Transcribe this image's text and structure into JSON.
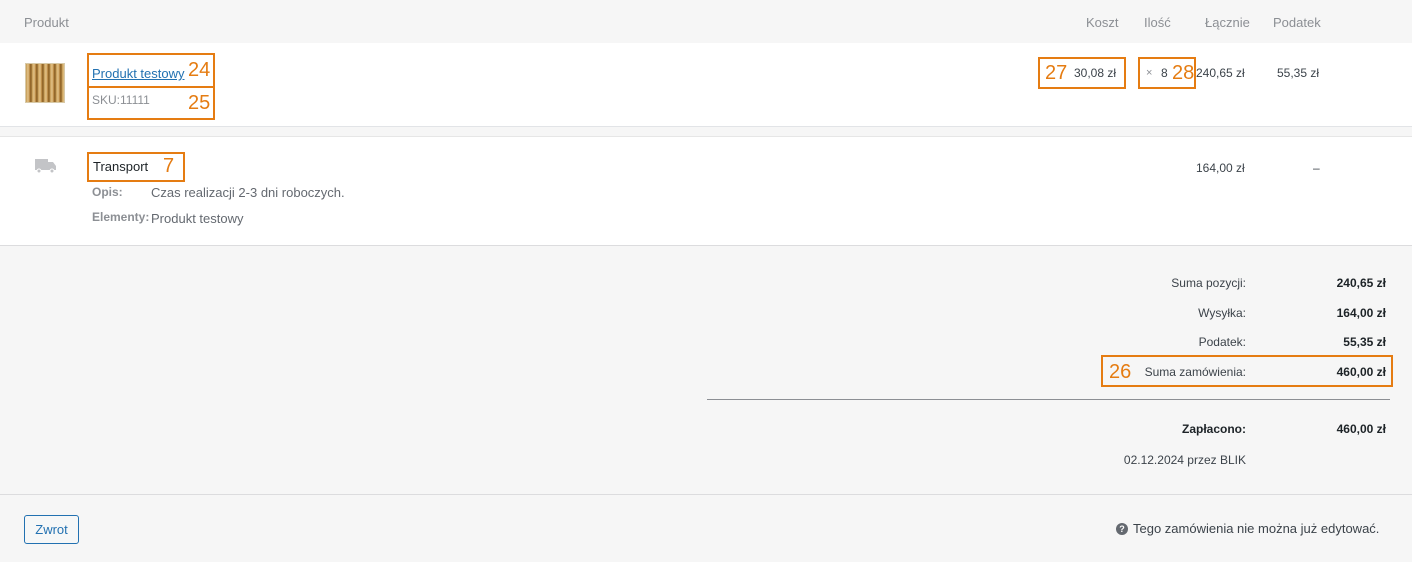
{
  "header": {
    "product": "Produkt",
    "cost": "Koszt",
    "qty": "Ilość",
    "total": "Łącznie",
    "tax": "Podatek"
  },
  "item": {
    "name": "Produkt testowy",
    "sku": "SKU:11111",
    "cost": "30,08 zł",
    "qty_prefix": "×",
    "qty": "8",
    "total": "240,65 zł",
    "tax": "55,35 zł"
  },
  "shipping": {
    "name": "Transport",
    "desc_label": "Opis:",
    "desc_value": "Czas realizacji 2-3 dni roboczych.",
    "items_label": "Elementy:",
    "items_value": "Produkt testowy",
    "total": "164,00 zł",
    "tax": "–"
  },
  "totals": {
    "subtotal_label": "Suma pozycji:",
    "subtotal_value": "240,65 zł",
    "shipping_label": "Wysyłka:",
    "shipping_value": "164,00 zł",
    "tax_label": "Podatek:",
    "tax_value": "55,35 zł",
    "order_label": "Suma zamówienia:",
    "order_value": "460,00 zł",
    "paid_label": "Zapłacono:",
    "paid_value": "460,00 zł",
    "paid_note": "02.12.2024 przez BLIK"
  },
  "footer": {
    "refund_button": "Zwrot",
    "help_glyph": "?",
    "notice": "Tego zamówienia nie można już edytować."
  },
  "annotations": {
    "a24": "24",
    "a25": "25",
    "a7": "7",
    "a26": "26",
    "a27": "27",
    "a28": "28"
  },
  "colors": {
    "link": "#2271b1",
    "annotation": "#e57c12"
  }
}
